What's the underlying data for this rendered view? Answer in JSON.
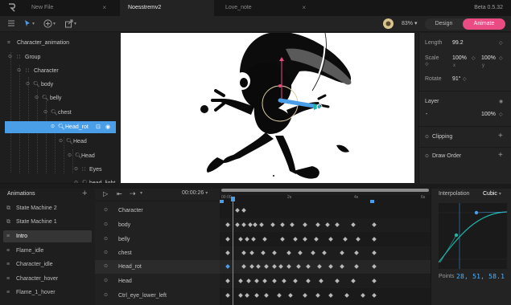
{
  "tabs": [
    {
      "label": "New File",
      "icon": "close-icon"
    },
    {
      "label": "Noesstremv2",
      "active": true
    },
    {
      "label": "Love_note",
      "icon": "close-icon"
    }
  ],
  "app": {
    "version": "Beta 0.5.32"
  },
  "toolbar": {
    "zoom": "83%",
    "design_label": "Design",
    "animate_label": "Animate",
    "accent_color": "#e94b82",
    "icons": [
      "menu-icon",
      "select-arrow-icon",
      "add-icon",
      "share-icon"
    ]
  },
  "hierarchy": [
    {
      "label": "Character_animation",
      "icon": "artboard-icon"
    },
    {
      "label": "Group",
      "icon": "group-icon"
    },
    {
      "label": "Character",
      "icon": "group-icon"
    },
    {
      "label": "body",
      "icon": "bone-icon"
    },
    {
      "label": "belly",
      "icon": "bone-icon"
    },
    {
      "label": "chest",
      "icon": "bone-icon"
    },
    {
      "label": "Head_rot",
      "icon": "bone-icon",
      "selected": true
    },
    {
      "label": "Head",
      "icon": "bone-icon"
    },
    {
      "label": "Head",
      "icon": "bone-icon"
    },
    {
      "label": "Eyes",
      "icon": "group-icon"
    },
    {
      "label": "head_light",
      "icon": "bone-icon"
    }
  ],
  "inspector": {
    "length_label": "Length",
    "length_value": "99.2",
    "scale_label": "Scale",
    "scale_x": "100%",
    "scale_y": "100%",
    "scale_x_sub": "x",
    "scale_y_sub": "y",
    "rotate_label": "Rotate",
    "rotate_value": "91°",
    "layer_label": "Layer",
    "layer_blend": "-",
    "layer_opacity": "100%",
    "clipping_label": "Clipping",
    "draw_order_label": "Draw Order"
  },
  "animations": {
    "title": "Animations",
    "items": [
      {
        "label": "State Machine 2",
        "icon": "state-machine-icon"
      },
      {
        "label": "State Machine 1",
        "icon": "state-machine-icon"
      },
      {
        "label": "Intro",
        "icon": "timeline-icon",
        "selected": true
      },
      {
        "label": "Flame_idle",
        "icon": "timeline-icon"
      },
      {
        "label": "Character_idle",
        "icon": "timeline-icon"
      },
      {
        "label": "Character_hover",
        "icon": "timeline-icon"
      },
      {
        "label": "Flame_1_hover",
        "icon": "timeline-icon"
      }
    ]
  },
  "timeline": {
    "current_time": "00:00:26",
    "ticks": [
      "00:00",
      "2s",
      "4s",
      "6s"
    ],
    "playhead_color": "#4a9ee8",
    "tracks": [
      {
        "label": "Character",
        "icon": "group-icon",
        "keys": [
          0.08,
          0.12
        ]
      },
      {
        "label": "body",
        "icon": "bone-icon",
        "keys": [
          0.02,
          0.08,
          0.12,
          0.16,
          0.19,
          0.23,
          0.3,
          0.36,
          0.42,
          0.5,
          0.58,
          0.64,
          0.7,
          0.8,
          0.93
        ]
      },
      {
        "label": "belly",
        "icon": "bone-icon",
        "keys": [
          0.02,
          0.1,
          0.14,
          0.18,
          0.25,
          0.36,
          0.44,
          0.5,
          0.57,
          0.66,
          0.75,
          0.83,
          0.93
        ]
      },
      {
        "label": "chest",
        "icon": "bone-icon",
        "keys": [
          0.02,
          0.12,
          0.17,
          0.24,
          0.31,
          0.4,
          0.47,
          0.55,
          0.62,
          0.73,
          0.82,
          0.93
        ]
      },
      {
        "label": "Head_rot",
        "icon": "bone-icon",
        "selected": true,
        "keys": [
          0.02,
          0.12,
          0.17,
          0.21,
          0.26,
          0.31,
          0.35,
          0.4,
          0.46,
          0.52,
          0.59,
          0.66,
          0.73,
          0.82,
          0.93
        ]
      },
      {
        "label": "Head",
        "icon": "bone-icon",
        "keys": [
          0.02,
          0.1,
          0.15,
          0.2,
          0.25,
          0.31,
          0.37,
          0.44,
          0.52,
          0.6,
          0.7,
          0.8,
          0.93
        ]
      },
      {
        "label": "Ctrl_eye_lower_left",
        "icon": "bone-icon",
        "keys": [
          0.02,
          0.1,
          0.14,
          0.2,
          0.26,
          0.34,
          0.41,
          0.5,
          0.58,
          0.66,
          0.76,
          0.86,
          0.93
        ]
      }
    ]
  },
  "interpolation": {
    "title": "Interpolation",
    "type": "Cubic",
    "points_label": "Points",
    "points_value": "28, 51, 58.1",
    "curve_color": "#1fb3a8"
  }
}
